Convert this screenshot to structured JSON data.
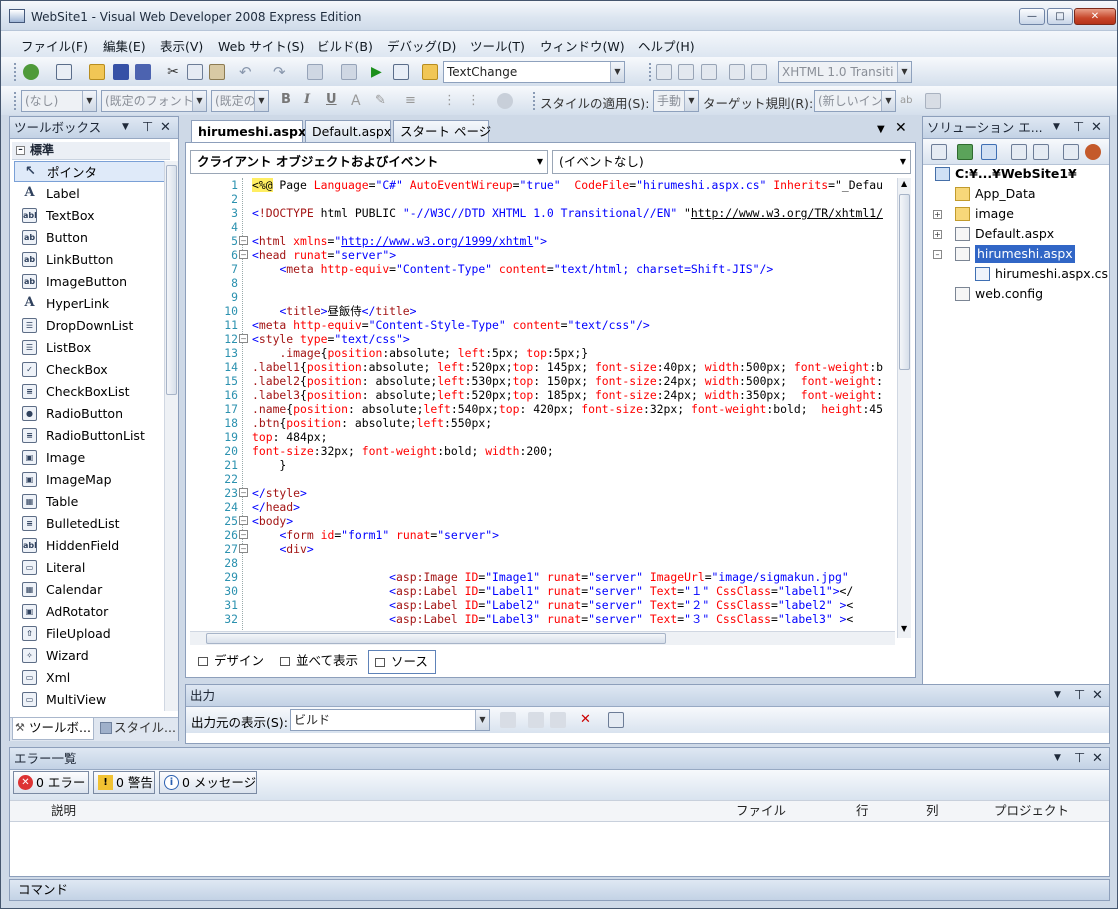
{
  "window": {
    "title": "WebSite1 - Visual Web Developer 2008 Express Edition"
  },
  "menu": [
    "ファイル(F)",
    "編集(E)",
    "表示(V)",
    "Web サイト(S)",
    "ビルド(B)",
    "デバッグ(D)",
    "ツール(T)",
    "ウィンドウ(W)",
    "ヘルプ(H)"
  ],
  "toolbar1": {
    "find_value": "TextChange",
    "doctype_value": "XHTML 1.0 Transiti"
  },
  "toolbar2": {
    "style_block": "(なし)",
    "font_name": "(既定のフォント",
    "font_size": "(既定の",
    "bold": "B",
    "italic": "I",
    "underline": "U",
    "apply_style_label": "スタイルの適用(S):",
    "apply_style_value": "手動",
    "target_rule_label": "ターゲット規則(R):",
    "target_rule_value": "(新しいイン"
  },
  "toolbox": {
    "title": "ツールボックス",
    "group": "標準",
    "items": [
      "ポインタ",
      "Label",
      "TextBox",
      "Button",
      "LinkButton",
      "ImageButton",
      "HyperLink",
      "DropDownList",
      "ListBox",
      "CheckBox",
      "CheckBoxList",
      "RadioButton",
      "RadioButtonList",
      "Image",
      "ImageMap",
      "Table",
      "BulletedList",
      "HiddenField",
      "Literal",
      "Calendar",
      "AdRotator",
      "FileUpload",
      "Wizard",
      "Xml",
      "MultiView"
    ],
    "icons": [
      "pointer-icon",
      "label-icon",
      "textbox-icon",
      "button-icon",
      "linkbutton-icon",
      "imagebutton-icon",
      "hyperlink-icon",
      "dropdownlist-icon",
      "listbox-icon",
      "checkbox-icon",
      "checkboxlist-icon",
      "radiobutton-icon",
      "radiobuttonlist-icon",
      "image-icon",
      "imagemap-icon",
      "table-icon",
      "bulletedlist-icon",
      "hiddenfield-icon",
      "literal-icon",
      "calendar-icon",
      "adrotator-icon",
      "fileupload-icon",
      "wizard-icon",
      "xml-icon",
      "multiview-icon"
    ],
    "bottom_tabs": [
      "ツールボ...",
      "スタイル..."
    ]
  },
  "editor": {
    "tabs": [
      "hirumeshi.aspx",
      "Default.aspx",
      "スタート ページ"
    ],
    "object_combo": "クライアント オブジェクトおよびイベント",
    "event_combo": "(イベントなし)",
    "view_tabs": [
      "デザイン",
      "並べて表示",
      "ソース"
    ],
    "lines": [
      {
        "n": "1",
        "t": "<%@ Page Language=\"C#\" AutoEventWireup=\"true\"  CodeFile=\"hirumeshi.aspx.cs\" Inherits=\"_Defau"
      },
      {
        "n": "2",
        "t": ""
      },
      {
        "n": "3",
        "t": "<!DOCTYPE html PUBLIC \"-//W3C//DTD XHTML 1.0 Transitional//EN\" \"http://www.w3.org/TR/xhtml1/"
      },
      {
        "n": "4",
        "t": ""
      },
      {
        "n": "5",
        "t": "<html xmlns=\"http://www.w3.org/1999/xhtml\">"
      },
      {
        "n": "6",
        "t": "<head runat=\"server\">"
      },
      {
        "n": "7",
        "t": "    <meta http-equiv=\"Content-Type\" content=\"text/html; charset=Shift-JIS\"/>"
      },
      {
        "n": "8",
        "t": ""
      },
      {
        "n": "9",
        "t": ""
      },
      {
        "n": "10",
        "t": "    <title>昼飯侍</title>"
      },
      {
        "n": "11",
        "t": "<meta http-equiv=\"Content-Style-Type\" content=\"text/css\"/>"
      },
      {
        "n": "12",
        "t": "<style type=\"text/css\">"
      },
      {
        "n": "13",
        "t": "    .image{position:absolute; left:5px; top:5px;}"
      },
      {
        "n": "14",
        "t": ".label1{position:absolute; left:520px;top: 145px; font-size:40px; width:500px; font-weight:b"
      },
      {
        "n": "15",
        "t": ".label2{position: absolute;left:530px;top: 150px; font-size:24px; width:500px;  font-weight:"
      },
      {
        "n": "16",
        "t": ".label3{position: absolute;left:520px;top: 185px; font-size:24px; width:350px;  font-weight:"
      },
      {
        "n": "17",
        "t": ".name{position: absolute;left:540px;top: 420px; font-size:32px; font-weight:bold;  height:45"
      },
      {
        "n": "18",
        "t": ".btn{position: absolute;left:550px;"
      },
      {
        "n": "19",
        "t": "top: 484px;"
      },
      {
        "n": "20",
        "t": "font-size:32px; font-weight:bold; width:200;"
      },
      {
        "n": "21",
        "t": "    }"
      },
      {
        "n": "22",
        "t": ""
      },
      {
        "n": "23",
        "t": "</style>"
      },
      {
        "n": "24",
        "t": "</head>"
      },
      {
        "n": "25",
        "t": "<body>"
      },
      {
        "n": "26",
        "t": "    <form id=\"form1\" runat=\"server\">"
      },
      {
        "n": "27",
        "t": "    <div>"
      },
      {
        "n": "28",
        "t": ""
      },
      {
        "n": "29",
        "t": "                    <asp:Image ID=\"Image1\" runat=\"server\" ImageUrl=\"image/sigmakun.jpg\""
      },
      {
        "n": "30",
        "t": "                    <asp:Label ID=\"Label1\" runat=\"server\" Text=\"１\" CssClass=\"label1\"></"
      },
      {
        "n": "31",
        "t": "                    <asp:Label ID=\"Label2\" runat=\"server\" Text=\"２\" CssClass=\"label2\" ><"
      },
      {
        "n": "32",
        "t": "                    <asp:Label ID=\"Label3\" runat=\"server\" Text=\"３\" CssClass=\"label3\" ><"
      }
    ]
  },
  "solution": {
    "title": "ソリューション エ...",
    "root": "C:¥...¥WebSite1¥",
    "items": [
      "App_Data",
      "image",
      "Default.aspx",
      "hirumeshi.aspx",
      "hirumeshi.aspx.cs",
      "web.config"
    ]
  },
  "output": {
    "title": "出力",
    "source_label": "出力元の表示(S):",
    "source_value": "ビルド"
  },
  "errorlist": {
    "title": "エラー一覧",
    "errors": "0 エラー",
    "warnings": "0 警告",
    "messages": "0 メッセージ",
    "columns": [
      "説明",
      "ファイル",
      "行",
      "列",
      "プロジェクト"
    ]
  },
  "command": {
    "title": "コマンド"
  },
  "colors": {
    "accent": "#3166c6",
    "keyword": "#0000ff",
    "tag": "#a31515",
    "attr": "#ff0000",
    "linenum": "#2b91af"
  }
}
